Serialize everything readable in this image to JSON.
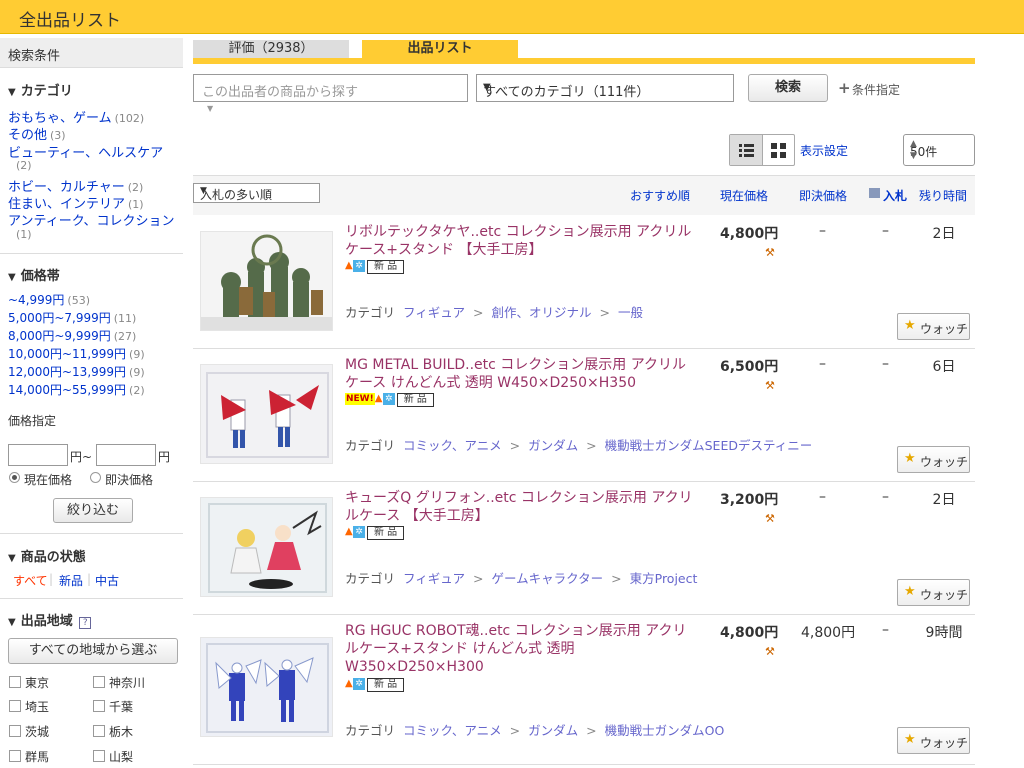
{
  "header": {
    "title": "全出品リスト"
  },
  "sidebar": {
    "search_conditions": "検索条件",
    "category": {
      "title": "カテゴリ",
      "items": [
        {
          "label": "おもちゃ、ゲーム",
          "count": "(102)"
        },
        {
          "label": "その他",
          "count": "(3)"
        },
        {
          "label": "ビューティー、ヘルスケア",
          "count": "(2)"
        },
        {
          "label": "ホビー、カルチャー",
          "count": "(2)"
        },
        {
          "label": "住まい、インテリア",
          "count": "(1)"
        },
        {
          "label": "アンティーク、コレクション",
          "count": "(1)"
        }
      ]
    },
    "price_range": {
      "title": "価格帯",
      "items": [
        {
          "label": "~4,999円",
          "count": "(53)"
        },
        {
          "label": "5,000円~7,999円",
          "count": "(11)"
        },
        {
          "label": "8,000円~9,999円",
          "count": "(27)"
        },
        {
          "label": "10,000円~11,999円",
          "count": "(9)"
        },
        {
          "label": "12,000円~13,999円",
          "count": "(9)"
        },
        {
          "label": "14,000円~55,999円",
          "count": "(2)"
        }
      ]
    },
    "price_spec": {
      "label": "価格指定",
      "yen1": "円~",
      "yen2": "円",
      "radio_current": "現在価格",
      "radio_bin": "即決価格",
      "filter_button": "絞り込む"
    },
    "condition": {
      "title": "商品の状態",
      "all": "すべて",
      "new": "新品",
      "used": "中古"
    },
    "region": {
      "title": "出品地域",
      "help": "?",
      "select_button": "すべての地域から選ぶ",
      "prefs": [
        "東京",
        "神奈川",
        "埼玉",
        "千葉",
        "茨城",
        "栃木",
        "群馬",
        "山梨"
      ]
    }
  },
  "tabs": {
    "rating": "評価（2938）",
    "listing": "出品リスト"
  },
  "search": {
    "placeholder": "この出品者の商品から探す",
    "category_select": "すべてのカテゴリ（111件）",
    "search_button": "検索",
    "advanced": "条件指定"
  },
  "view": {
    "display_settings": "表示設定",
    "per_page": "50件"
  },
  "sort": {
    "selected": "入札の多い順",
    "col_recommend": "おすすめ順",
    "col_price": "現在価格",
    "col_bin": "即決価格",
    "col_bids": "入札",
    "col_time": "残り時間"
  },
  "labels": {
    "category": "カテゴリ",
    "watch": "ウォッチ",
    "new_badge": "新 品",
    "new_tag": "NEW!"
  },
  "items": [
    {
      "title": "リボルテックタケヤ..etc コレクション展示用 アクリルケース+スタンド 【大手工房】",
      "price": "4,800円",
      "bin": "–",
      "bids": "–",
      "time": "2日",
      "cats": [
        "フィギュア",
        "創作、オリジナル",
        "一般"
      ],
      "new_tag": false
    },
    {
      "title": "MG METAL BUILD..etc コレクション展示用 アクリルケース けんどん式 透明 W450×D250×H350",
      "price": "6,500円",
      "bin": "–",
      "bids": "–",
      "time": "6日",
      "cats": [
        "コミック、アニメ",
        "ガンダム",
        "機動戦士ガンダムSEEDデスティニー"
      ],
      "new_tag": true
    },
    {
      "title": "キューズQ グリフォン..etc コレクション展示用 アクリルケース 【大手工房】",
      "price": "3,200円",
      "bin": "–",
      "bids": "–",
      "time": "2日",
      "cats": [
        "フィギュア",
        "ゲームキャラクター",
        "東方Project"
      ],
      "new_tag": false
    },
    {
      "title": "RG HGUC ROBOT魂..etc コレクション展示用 アクリルケース+スタンド けんどん式 透明 W350×D250×H300",
      "price": "4,800円",
      "bin": "4,800円",
      "bids": "–",
      "time": "9時間",
      "cats": [
        "コミック、アニメ",
        "ガンダム",
        "機動戦士ガンダムOO"
      ],
      "new_tag": false
    }
  ],
  "colors": {
    "brand_yellow": "#ffcc33",
    "link": "#0033cc",
    "title": "#993366"
  }
}
